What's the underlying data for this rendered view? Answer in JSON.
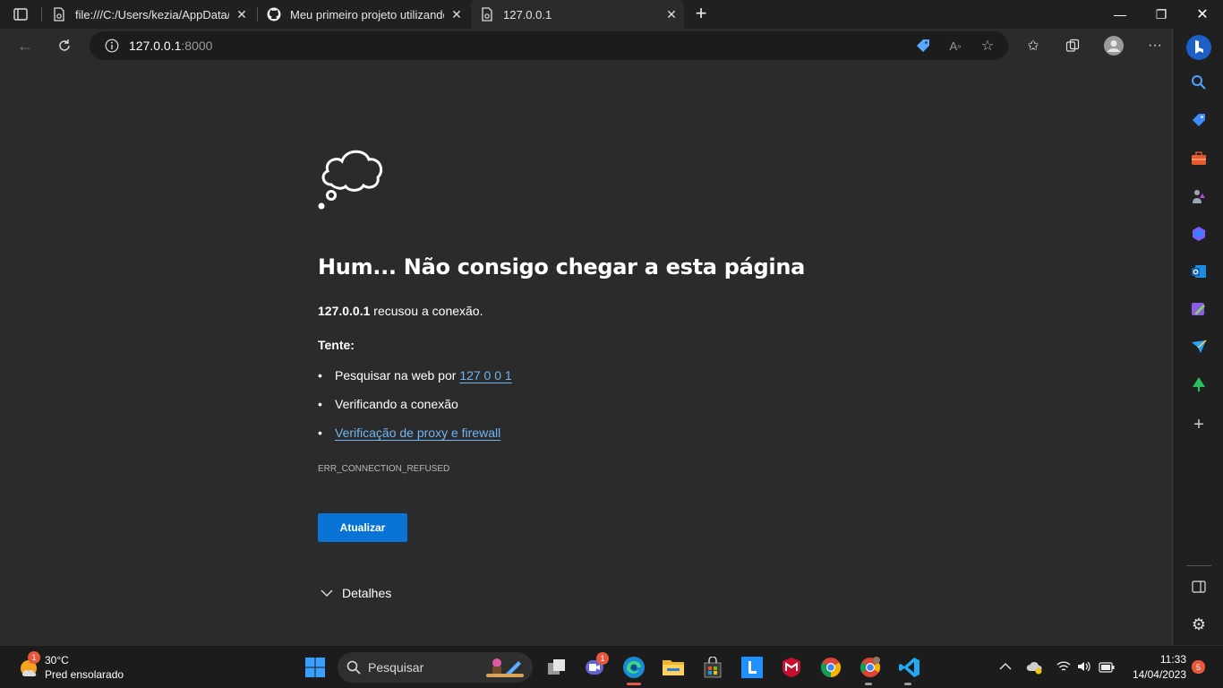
{
  "browser": {
    "tabs": [
      {
        "title": "file:///C:/Users/kezia/AppData/Lo",
        "favicon": "file-icon"
      },
      {
        "title": "Meu primeiro projeto utilizando o",
        "favicon": "github-icon"
      },
      {
        "title": "127.0.0.1",
        "favicon": "file-icon",
        "active": true
      }
    ],
    "address": {
      "host": "127.0.0.1",
      "port": ":8000"
    }
  },
  "error_page": {
    "heading": "Hum... Não consigo chegar a esta página",
    "refused_host": "127.0.0.1",
    "refused_text": " recusou a conexão.",
    "try_label": "Tente:",
    "suggestions": {
      "search_prefix": "Pesquisar na web por ",
      "search_link": "127 0 0 1",
      "check_connection": "Verificando a conexão",
      "proxy_link": "Verificação de proxy e firewall"
    },
    "error_code": "ERR_CONNECTION_REFUSED",
    "refresh_label": "Atualizar",
    "details_label": "Detalhes"
  },
  "taskbar": {
    "weather": {
      "temp": "30°C",
      "desc": "Pred ensolarado",
      "badge": "1"
    },
    "search_label": "Pesquisar",
    "teams_badge": "1",
    "clock": {
      "time": "11:33",
      "date": "14/04/2023"
    },
    "notification_count": "5"
  },
  "colors": {
    "accent": "#0a74d6",
    "link": "#6fb6f4",
    "page_bg": "#2b2b2b"
  }
}
